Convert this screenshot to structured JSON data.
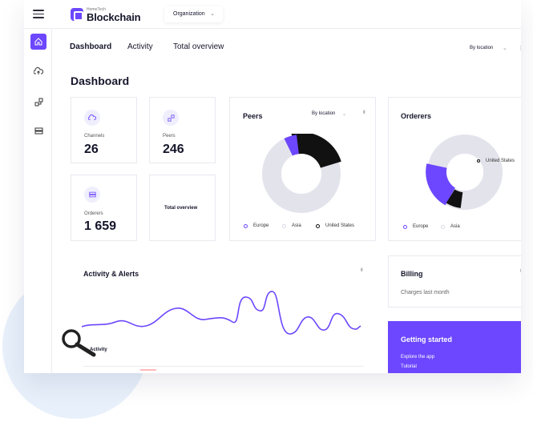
{
  "header": {
    "brand_small": "HomeTech",
    "brand": "Blockchain",
    "organization_label": "Organization"
  },
  "tabs": [
    "Dashboard",
    "Activity",
    "Total overview"
  ],
  "location_filter": "By location",
  "page_title": "Dashboard",
  "stats": [
    {
      "label": "Channels",
      "value": "26",
      "icon": "cloud-upload-icon"
    },
    {
      "label": "Peers",
      "value": "246",
      "icon": "share-icon"
    },
    {
      "label": "Orderers",
      "value": "1 659",
      "icon": "server-icon"
    }
  ],
  "total_overview_card": "Total overview",
  "peers": {
    "title": "Peers",
    "filter": "By location",
    "legend": [
      {
        "name": "Europe",
        "color": "#6c47ff"
      },
      {
        "name": "Asia",
        "color": "#d9d9e4"
      },
      {
        "name": "United States",
        "color": "#111111"
      }
    ]
  },
  "orderers": {
    "title": "Orderers",
    "callout": "United States",
    "legend": [
      {
        "name": "Europe",
        "color": "#6c47ff"
      },
      {
        "name": "Asia",
        "color": "#d9d9e4"
      }
    ]
  },
  "activity": {
    "title": "Activity & Alerts",
    "series_label": "Activity"
  },
  "billing": {
    "title": "Billing",
    "subtitle": "Charges last month"
  },
  "getting_started": {
    "title": "Getting started",
    "links": [
      "Explore the app",
      "Tutorial"
    ]
  },
  "colors": {
    "accent": "#6c47ff",
    "ring_grey": "#e3e3ec",
    "dark": "#111111"
  },
  "icons": [
    "menu-icon",
    "home-icon",
    "cloud-upload-icon",
    "share-icon",
    "server-icon",
    "chevron-down-icon",
    "more-icon",
    "magnifier-icon"
  ]
}
